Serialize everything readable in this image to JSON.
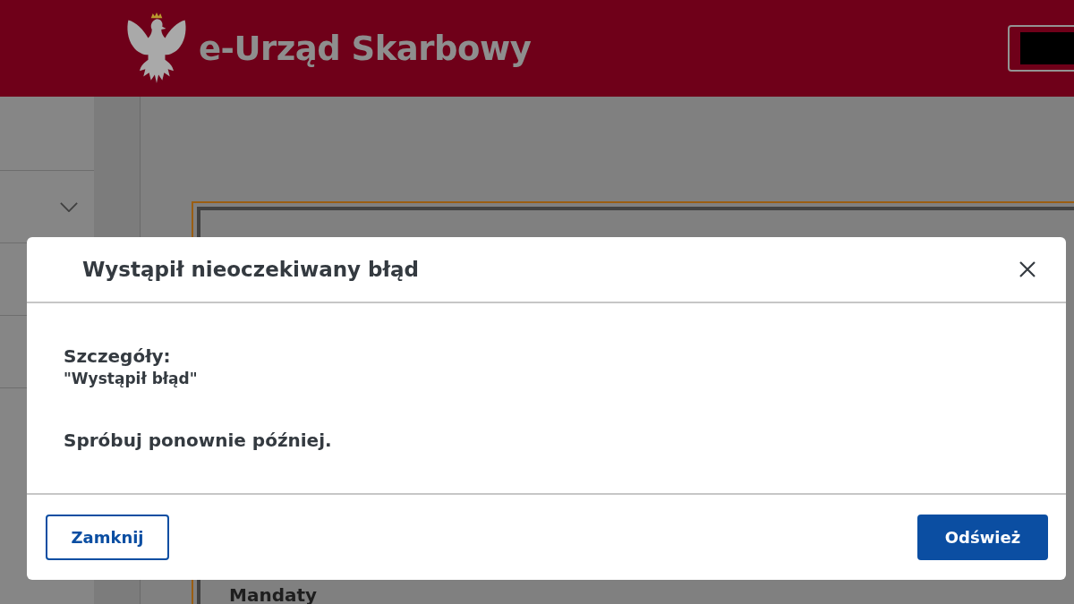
{
  "header": {
    "title": "e-Urząd Skarbowy"
  },
  "page": {
    "section_heading": "Mandaty"
  },
  "dialog": {
    "title": "Wystąpił nieoczekiwany błąd",
    "details_label": "Szczegóły:",
    "details": "\"Wystąpił błąd\"",
    "message": "Spróbuj ponownie później.",
    "buttons": [
      {
        "label": "Zamknij",
        "kind": "secondary"
      },
      {
        "label": "Odśwież",
        "kind": "primary"
      }
    ]
  }
}
